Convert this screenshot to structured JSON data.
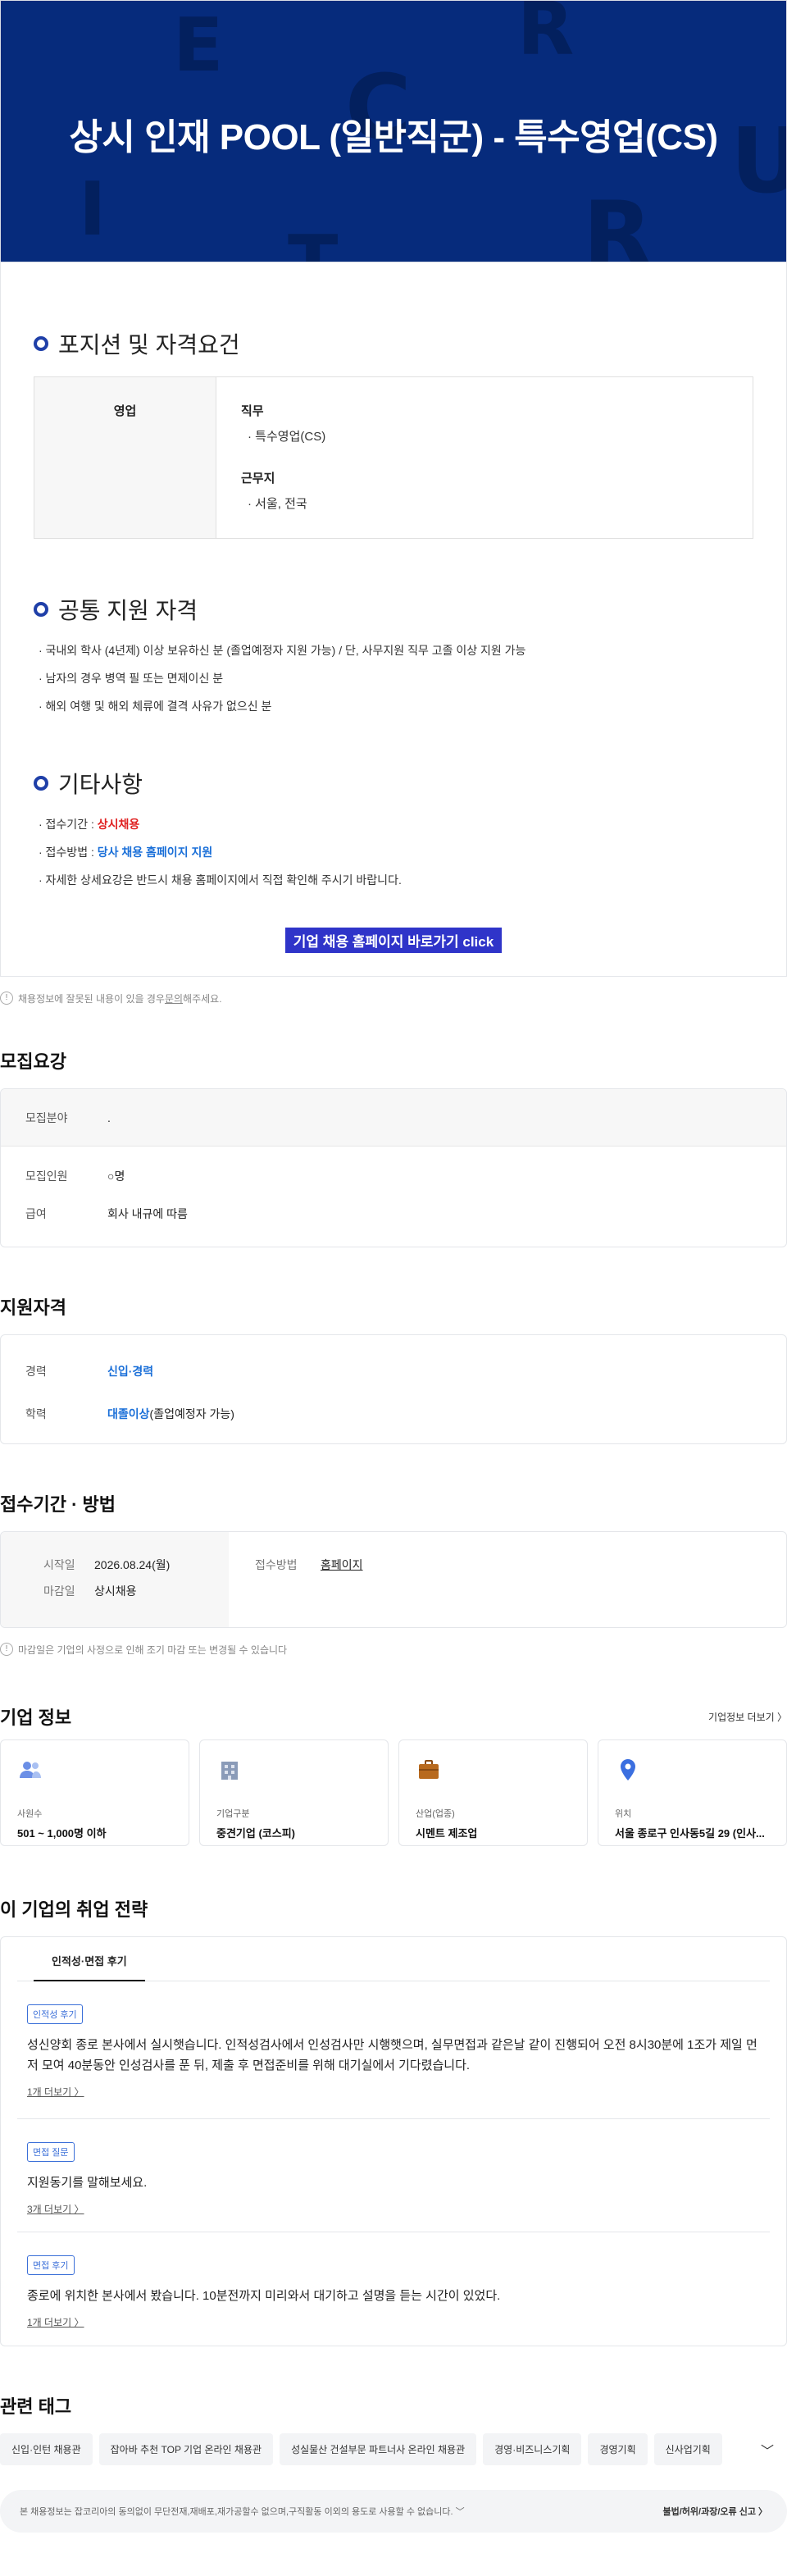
{
  "hero": {
    "title": "상시 인재 POOL (일반직군) - 특수영업(CS)",
    "deco_letters": [
      "E",
      "R",
      "C",
      "U",
      "I",
      "R",
      "T"
    ]
  },
  "detail": {
    "position_section_title": "포지션 및 자격요건",
    "position_table": {
      "left_label": "영업",
      "groups": [
        {
          "title": "직무",
          "item": "· 특수영업(CS)"
        },
        {
          "title": "근무지",
          "item": "· 서울, 전국"
        }
      ]
    },
    "common_section_title": "공통 지원 자격",
    "common_lines": [
      "· 국내외 학사 (4년제) 이상 보유하신 분 (졸업예정자 지원 가능) / 단, 사무지원 직무 고졸 이상 지원 가능",
      "· 남자의 경우 병역 필 또는 면제이신 분",
      "· 해외 여행 및 해외 체류에 결격 사유가 없으신 분"
    ],
    "etc_section_title": "기타사항",
    "etc_lines": {
      "period_label": "· 접수기간 : ",
      "period_value": "상시채용",
      "method_label": "· 접수방법 : ",
      "method_value": "당사 채용 홈페이지 지원",
      "note": "· 자세한 상세요강은 반드시 채용 홈페이지에서 직접 확인해 주시기 바랍니다."
    },
    "cta_label": "기업 채용 홈페이지 바로가기 click"
  },
  "notice1": {
    "icon_text": "!",
    "text_before": "채용정보에 잘못된 내용이 있을 경우 ",
    "link": "문의",
    "text_after": "해주세요."
  },
  "recruit": {
    "title": "모집요강",
    "rows": [
      {
        "key": "모집분야",
        "value": "."
      },
      {
        "key": "모집인원",
        "value": "○명"
      },
      {
        "key": "급여",
        "value": "회사 내규에 따름"
      }
    ]
  },
  "qualification": {
    "title": "지원자격",
    "career_key": "경력",
    "career_value": "신입·경력",
    "edu_key": "학력",
    "edu_value": "대졸이상",
    "edu_note": " (졸업예정자 가능)"
  },
  "period": {
    "title": "접수기간 · 방법",
    "start_key": "시작일",
    "start_value": "2026.08.24(월)",
    "end_key": "마감일",
    "end_value": "상시채용",
    "method_key": "접수방법",
    "method_value": "홈페이지",
    "notice_icon": "!",
    "notice": "마감일은 기업의 사정으로 인해 조기 마감 또는 변경될 수 있습니다"
  },
  "company": {
    "title": "기업 정보",
    "more": "기업정보 더보기 〉",
    "cards": [
      {
        "icon": "people-icon",
        "label": "사원수",
        "value": "501 ~ 1,000명 이하"
      },
      {
        "icon": "building-icon",
        "label": "기업구분",
        "value": "중견기업 (코스피)"
      },
      {
        "icon": "briefcase-icon",
        "label": "산업(업종)",
        "value": "시멘트 제조업"
      },
      {
        "icon": "location-pin-icon",
        "label": "위치",
        "value": "서울 종로구 인사동5길 29 (인사..."
      }
    ]
  },
  "strategy": {
    "title": "이 기업의 취업 전략",
    "tab": "인적성·면접 후기",
    "reviews": [
      {
        "badge": "인적성 후기",
        "text": "성신양회 종로 본사에서 실시햇습니다. 인적성검사에서 인성검사만 시행햇으며, 실무면접과 같은날 같이 진행되어 오전 8시30분에 1조가 제일 먼저 모여 40분동안 인성검사를 푼 뒤, 제출 후 면접준비를 위해 대기실에서 기다렸습니다.",
        "more": "1개 더보기 〉"
      },
      {
        "badge": "면접 질문",
        "text": "지원동기를 말해보세요.",
        "more": "3개 더보기 〉"
      },
      {
        "badge": "면접 후기",
        "text": "종로에 위치한 본사에서 봤습니다. 10분전까지 미리와서 대기하고 설명을 듣는 시간이 있었다.",
        "more": "1개 더보기 〉"
      }
    ]
  },
  "tags": {
    "title": "관련 태그",
    "items": [
      "신입·인턴 채용관",
      "잡아바 추천 TOP 기업 온라인 채용관",
      "성실물산 건설부문 파트너사 온라인 채용관",
      "경영·비즈니스기획",
      "경영기획",
      "신사업기획"
    ],
    "expand_icon": "﹀"
  },
  "footer": {
    "text": "본 채용정보는 잡코리아의 동의없이 무단전재,재배포,재가공할수 없으며,구직활동 이외의 용도로 사용할 수 없습니다. ﹀",
    "report": "불법/허위/과장/오류 신고 〉"
  }
}
